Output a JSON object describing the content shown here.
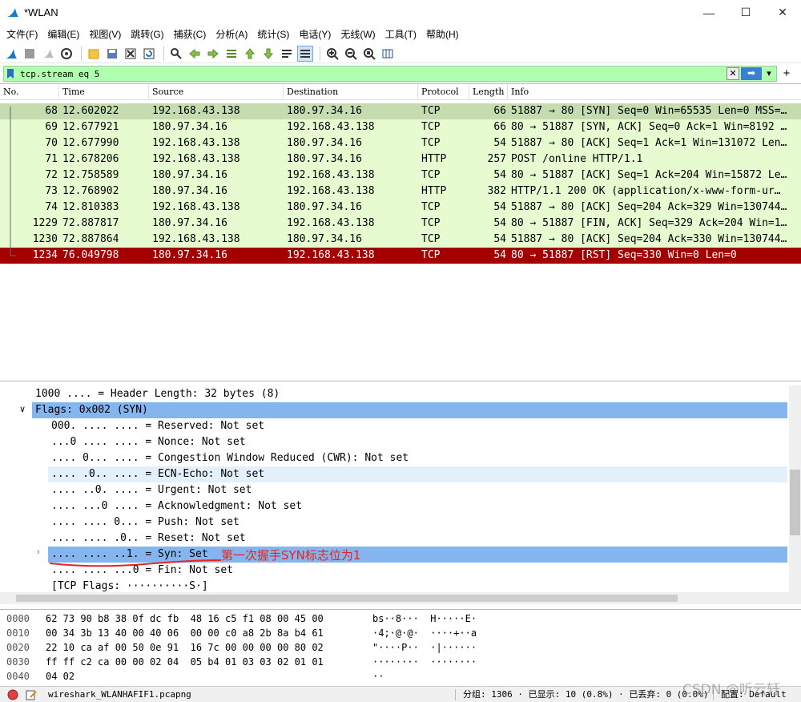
{
  "window": {
    "title": "*WLAN",
    "minimize": "—",
    "maximize": "☐",
    "close": "✕"
  },
  "menu": [
    "文件(F)",
    "编辑(E)",
    "视图(V)",
    "跳转(G)",
    "捕获(C)",
    "分析(A)",
    "统计(S)",
    "电话(Y)",
    "无线(W)",
    "工具(T)",
    "帮助(H)"
  ],
  "filter": {
    "value": "tcp.stream eq 5",
    "clear": "✕",
    "apply": "➡",
    "dropdown": "▾",
    "add": "+"
  },
  "columns": [
    "No.",
    "Time",
    "Source",
    "Destination",
    "Protocol",
    "Length",
    "Info"
  ],
  "packets": [
    {
      "no": "68",
      "time": "12.602022",
      "src": "192.168.43.138",
      "dst": "180.97.34.16",
      "proto": "TCP",
      "len": "66",
      "info": "51887 → 80 [SYN] Seq=0 Win=65535 Len=0 MSS=…"
    },
    {
      "no": "69",
      "time": "12.677921",
      "src": "180.97.34.16",
      "dst": "192.168.43.138",
      "proto": "TCP",
      "len": "66",
      "info": "80 → 51887 [SYN, ACK] Seq=0 Ack=1 Win=8192 …"
    },
    {
      "no": "70",
      "time": "12.677990",
      "src": "192.168.43.138",
      "dst": "180.97.34.16",
      "proto": "TCP",
      "len": "54",
      "info": "51887 → 80 [ACK] Seq=1 Ack=1 Win=131072 Len…"
    },
    {
      "no": "71",
      "time": "12.678206",
      "src": "192.168.43.138",
      "dst": "180.97.34.16",
      "proto": "HTTP",
      "len": "257",
      "info": "POST /online HTTP/1.1"
    },
    {
      "no": "72",
      "time": "12.758589",
      "src": "180.97.34.16",
      "dst": "192.168.43.138",
      "proto": "TCP",
      "len": "54",
      "info": "80 → 51887 [ACK] Seq=1 Ack=204 Win=15872 Le…"
    },
    {
      "no": "73",
      "time": "12.768902",
      "src": "180.97.34.16",
      "dst": "192.168.43.138",
      "proto": "HTTP",
      "len": "382",
      "info": "HTTP/1.1 200 OK  (application/x-www-form-ur…"
    },
    {
      "no": "74",
      "time": "12.810383",
      "src": "192.168.43.138",
      "dst": "180.97.34.16",
      "proto": "TCP",
      "len": "54",
      "info": "51887 → 80 [ACK] Seq=204 Ack=329 Win=130744…"
    },
    {
      "no": "1229",
      "time": "72.887817",
      "src": "180.97.34.16",
      "dst": "192.168.43.138",
      "proto": "TCP",
      "len": "54",
      "info": "80 → 51887 [FIN, ACK] Seq=329 Ack=204 Win=1…"
    },
    {
      "no": "1230",
      "time": "72.887864",
      "src": "192.168.43.138",
      "dst": "180.97.34.16",
      "proto": "TCP",
      "len": "54",
      "info": "51887 → 80 [ACK] Seq=204 Ack=330 Win=130744…"
    },
    {
      "no": "1234",
      "time": "76.049798",
      "src": "180.97.34.16",
      "dst": "192.168.43.138",
      "proto": "TCP",
      "len": "54",
      "info": "80 → 51887 [RST] Seq=330 Win=0 Len=0"
    }
  ],
  "details": [
    "1000 .... = Header Length: 32 bytes (8)",
    "Flags: 0x002 (SYN)",
    "000. .... .... = Reserved: Not set",
    "...0 .... .... = Nonce: Not set",
    ".... 0... .... = Congestion Window Reduced (CWR): Not set",
    ".... .0.. .... = ECN-Echo: Not set",
    ".... ..0. .... = Urgent: Not set",
    ".... ...0 .... = Acknowledgment: Not set",
    ".... .... 0... = Push: Not set",
    ".... .... .0.. = Reset: Not set",
    ".... .... ..1. = Syn: Set",
    ".... .... ...0 = Fin: Not set",
    "[TCP Flags: ··········S·]"
  ],
  "annotation": "第一次握手SYN标志位为1",
  "bytes": [
    {
      "off": "0000",
      "hex": "62 73 90 b8 38 0f dc fb  48 16 c5 f1 08 00 45 00",
      "ascii": "bs··8···  H·····E·"
    },
    {
      "off": "0010",
      "hex": "00 34 3b 13 40 00 40 06  00 00 c0 a8 2b 8a b4 61",
      "ascii": "·4;·@·@·  ····+··a"
    },
    {
      "off": "0020",
      "hex": "22 10 ca af 00 50 0e 91  16 7c 00 00 00 00 80 02",
      "ascii": "\"····P··  ·|······"
    },
    {
      "off": "0030",
      "hex": "ff ff c2 ca 00 00 02 04  05 b4 01 03 03 02 01 01",
      "ascii": "········  ········"
    },
    {
      "off": "0040",
      "hex": "04 02",
      "ascii": "··"
    }
  ],
  "status": {
    "file": "wireshark_WLANHAFIF1.pcapng",
    "packets": "分组: 1306 · 已显示: 10 (0.8%) · 已丢弃: 0 (0.0%)",
    "profile": "配置: Default"
  },
  "watermark": "CSDN @听云轩",
  "colors": {
    "row_bg": "#e7fbd0",
    "row_selected": "#c5dcb0",
    "row_rst": "#a40000",
    "filter_ok": "#afffaf",
    "detail_highlight": "#84b5ef",
    "annotation": "#e8231d"
  }
}
